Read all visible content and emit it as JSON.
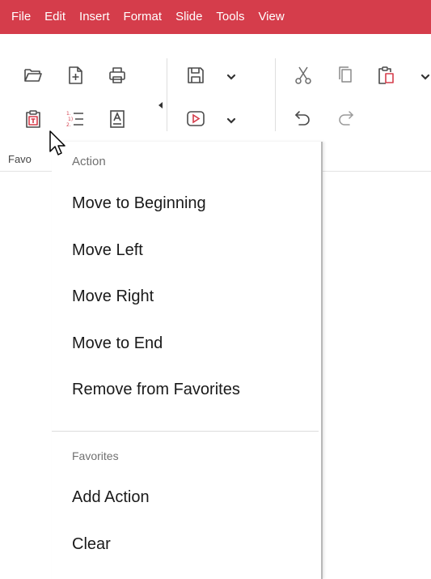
{
  "menubar": {
    "items": [
      "File",
      "Edit",
      "Insert",
      "Format",
      "Slide",
      "Tools",
      "View"
    ]
  },
  "toolbar": {
    "group_label": "Favo",
    "icons": [
      "folder-open-icon",
      "new-document-icon",
      "printer-icon",
      "save-icon",
      "chevron-down-icon",
      "cut-icon",
      "copy-icon",
      "paste-icon",
      "paste-text-icon",
      "numbered-list-icon",
      "text-box-icon",
      "slideshow-play-icon",
      "undo-icon",
      "redo-icon"
    ]
  },
  "context_menu": {
    "section1_header": "Action",
    "section1_items": [
      "Move to Beginning",
      "Move Left",
      "Move Right",
      "Move to End",
      "Remove from Favorites"
    ],
    "section2_header": "Favorites",
    "section2_items": [
      "Add Action",
      "Clear"
    ]
  },
  "colors": {
    "menubar_bg": "#d53d4b",
    "accent_red": "#d53d4b",
    "icon_stroke": "#4a4a4a"
  }
}
